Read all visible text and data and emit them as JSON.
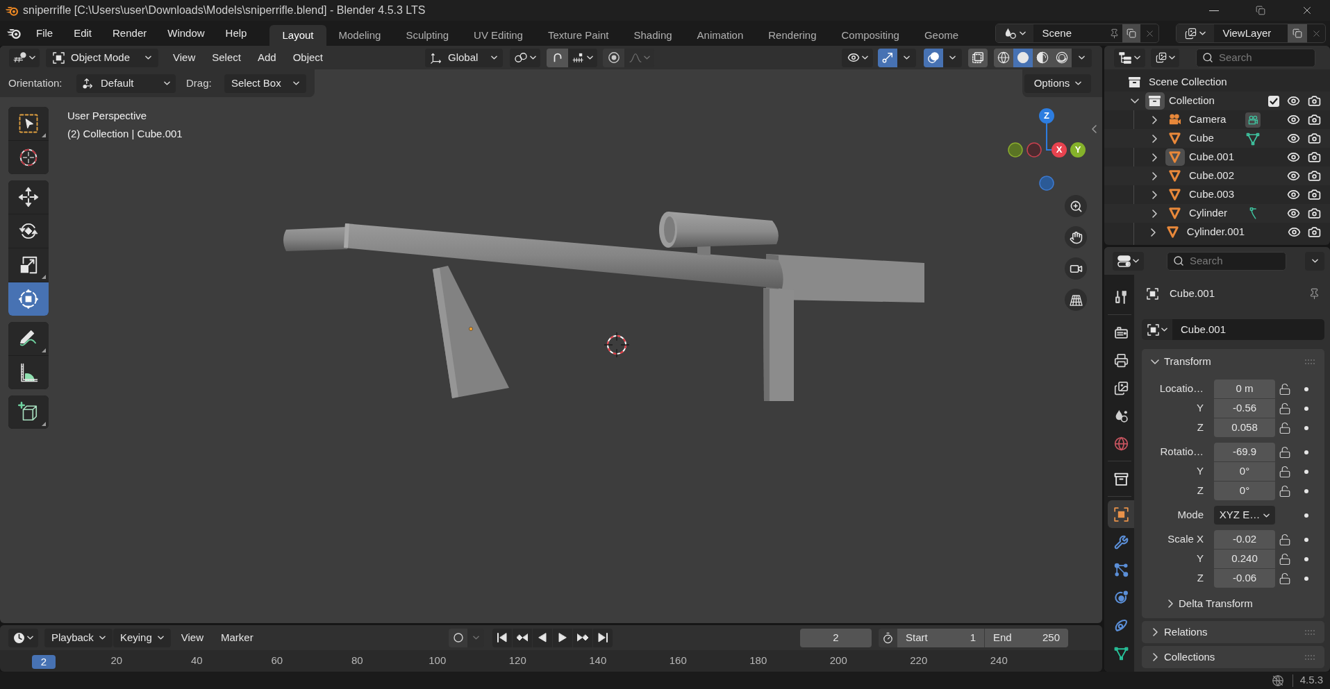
{
  "title_bar": {
    "title": "sniperrifle [C:\\Users\\user\\Downloads\\Models\\sniperrifle.blend] - Blender 4.5.3 LTS"
  },
  "menu": [
    "File",
    "Edit",
    "Render",
    "Window",
    "Help"
  ],
  "workspace_tabs": [
    {
      "label": "Layout",
      "selected": true
    },
    {
      "label": "Modeling",
      "selected": false
    },
    {
      "label": "Sculpting",
      "selected": false
    },
    {
      "label": "UV Editing",
      "selected": false
    },
    {
      "label": "Texture Paint",
      "selected": false
    },
    {
      "label": "Shading",
      "selected": false
    },
    {
      "label": "Animation",
      "selected": false
    },
    {
      "label": "Rendering",
      "selected": false
    },
    {
      "label": "Compositing",
      "selected": false
    },
    {
      "label": "Geome",
      "selected": false
    }
  ],
  "scene": {
    "name": "Scene"
  },
  "view_layer": {
    "name": "ViewLayer"
  },
  "viewport_header": {
    "mode": "Object Mode",
    "menus": [
      "View",
      "Select",
      "Add",
      "Object"
    ],
    "orientation": "Global",
    "snapping": {
      "on": false
    },
    "proportional_editing": {
      "on": false
    },
    "display_toggles": [
      {
        "kind": "gizmos",
        "on": true
      },
      {
        "kind": "overlays",
        "on": true
      },
      {
        "kind": "xray",
        "on": false
      }
    ],
    "shading": [
      {
        "kind": "wireframe",
        "selected": false
      },
      {
        "kind": "solid",
        "selected": true
      },
      {
        "kind": "material",
        "selected": false
      },
      {
        "kind": "rendered",
        "selected": false
      }
    ]
  },
  "tool_settings": {
    "orientation_label": "Orientation:",
    "orientation": "Default",
    "drag_label": "Drag:",
    "drag": "Select Box",
    "options": "Options"
  },
  "viewport": {
    "view_name": "User Perspective",
    "context": "(2) Collection | Cube.001",
    "tool_groups": [
      {
        "tools": [
          {
            "kind": "select",
            "selected": false,
            "submenu": true
          },
          {
            "kind": "cursor",
            "selected": false,
            "submenu": false
          }
        ]
      },
      {
        "tools": [
          {
            "kind": "move",
            "selected": false,
            "submenu": false
          },
          {
            "kind": "rotate",
            "selected": false,
            "submenu": false
          },
          {
            "kind": "scale",
            "selected": false,
            "submenu": true
          },
          {
            "kind": "transform",
            "selected": true,
            "submenu": false
          }
        ]
      },
      {
        "tools": [
          {
            "kind": "annotate",
            "selected": false,
            "submenu": true
          },
          {
            "kind": "measure",
            "selected": false,
            "submenu": false
          }
        ]
      },
      {
        "tools": [
          {
            "kind": "add_cube",
            "selected": false,
            "submenu": true
          }
        ]
      }
    ],
    "gizmo": {
      "axes": [
        {
          "label": "Z",
          "color": "#2d7de0"
        },
        {
          "label": "X",
          "color": "#e8434f"
        },
        {
          "label": "Y",
          "color": "#85b22a"
        }
      ]
    }
  },
  "timeline": {
    "menus": [
      {
        "label": "Playback",
        "kind": "dropdown"
      },
      {
        "label": "Keying",
        "kind": "dropdown"
      },
      {
        "label": "View",
        "kind": "menu"
      },
      {
        "label": "Marker",
        "kind": "menu"
      }
    ],
    "auto_keying": {
      "on": false
    },
    "current_frame": "2",
    "start_label": "Start",
    "start": "1",
    "end_label": "End",
    "end": "250",
    "ruler": {
      "playhead": "2",
      "ticks": [
        "20",
        "40",
        "60",
        "80",
        "100",
        "120",
        "140",
        "160",
        "180",
        "200",
        "220",
        "240"
      ]
    }
  },
  "outliner": {
    "search_placeholder": "Search",
    "tree": {
      "label": "Scene Collection",
      "kind": "scene_collection",
      "selected": false,
      "children": [
        {
          "label": "Collection",
          "kind": "collection",
          "expanded": true,
          "checked": true,
          "selected": true,
          "children": [
            {
              "label": "Camera",
              "kind": "camera",
              "expanded": false,
              "selected": false,
              "data": {
                "kind": "camera"
              }
            },
            {
              "label": "Cube",
              "kind": "mesh",
              "expanded": false,
              "selected": false,
              "data": {
                "kind": "mesh"
              }
            },
            {
              "label": "Cube.001",
              "kind": "mesh",
              "expanded": false,
              "selected": true
            },
            {
              "label": "Cube.002",
              "kind": "mesh",
              "expanded": false,
              "selected": false
            },
            {
              "label": "Cube.003",
              "kind": "mesh",
              "expanded": false,
              "selected": false
            },
            {
              "label": "Cylinder",
              "kind": "mesh",
              "expanded": false,
              "selected": false,
              "data": {
                "kind": "hook"
              }
            },
            {
              "label": "Cylinder.001",
              "kind": "mesh",
              "expanded": false,
              "selected": false
            }
          ]
        }
      ]
    }
  },
  "properties": {
    "search_placeholder": "Search",
    "tab_groups": [
      {
        "tabs": [
          {
            "kind": "tool",
            "selected": false
          }
        ]
      },
      {
        "tabs": [
          {
            "kind": "render",
            "selected": false
          },
          {
            "kind": "output",
            "selected": false
          },
          {
            "kind": "view_layer",
            "selected": false
          },
          {
            "kind": "scene",
            "selected": false
          },
          {
            "kind": "world",
            "selected": false
          }
        ]
      },
      {
        "tabs": [
          {
            "kind": "collection",
            "selected": false
          }
        ]
      },
      {
        "tabs": [
          {
            "kind": "object",
            "selected": true
          },
          {
            "kind": "modifiers",
            "selected": false
          },
          {
            "kind": "particles",
            "selected": false
          },
          {
            "kind": "physics",
            "selected": false
          },
          {
            "kind": "constraints",
            "selected": false
          },
          {
            "kind": "data",
            "selected": false
          }
        ]
      }
    ],
    "context": "Cube.001",
    "name": "Cube.001",
    "transform": {
      "title": "Transform",
      "expanded": true,
      "groups": [
        {
          "rows": [
            {
              "label": "Locatio…",
              "value": "0 m",
              "kind": "number"
            },
            {
              "label": "Y",
              "value": "-0.56",
              "kind": "number"
            },
            {
              "label": "Z",
              "value": "0.058",
              "kind": "number"
            }
          ]
        },
        {
          "rows": [
            {
              "label": "Rotatio…",
              "value": "-69.9",
              "kind": "number"
            },
            {
              "label": "Y",
              "value": "0°",
              "kind": "number"
            },
            {
              "label": "Z",
              "value": "0°",
              "kind": "number"
            }
          ]
        },
        {
          "rows": [
            {
              "label": "Mode",
              "value": "XYZ E…",
              "kind": "dropdown"
            }
          ]
        },
        {
          "rows": [
            {
              "label": "Scale X",
              "value": "-0.02",
              "kind": "number"
            },
            {
              "label": "Y",
              "value": "0.240",
              "kind": "number"
            },
            {
              "label": "Z",
              "value": "-0.06",
              "kind": "number"
            }
          ]
        }
      ],
      "subpanels": [
        {
          "title": "Delta Transform",
          "expanded": false
        }
      ]
    },
    "panels": [
      {
        "title": "Relations",
        "expanded": false
      },
      {
        "title": "Collections",
        "expanded": false
      }
    ]
  },
  "status_bar": {
    "version": "4.5.3"
  }
}
